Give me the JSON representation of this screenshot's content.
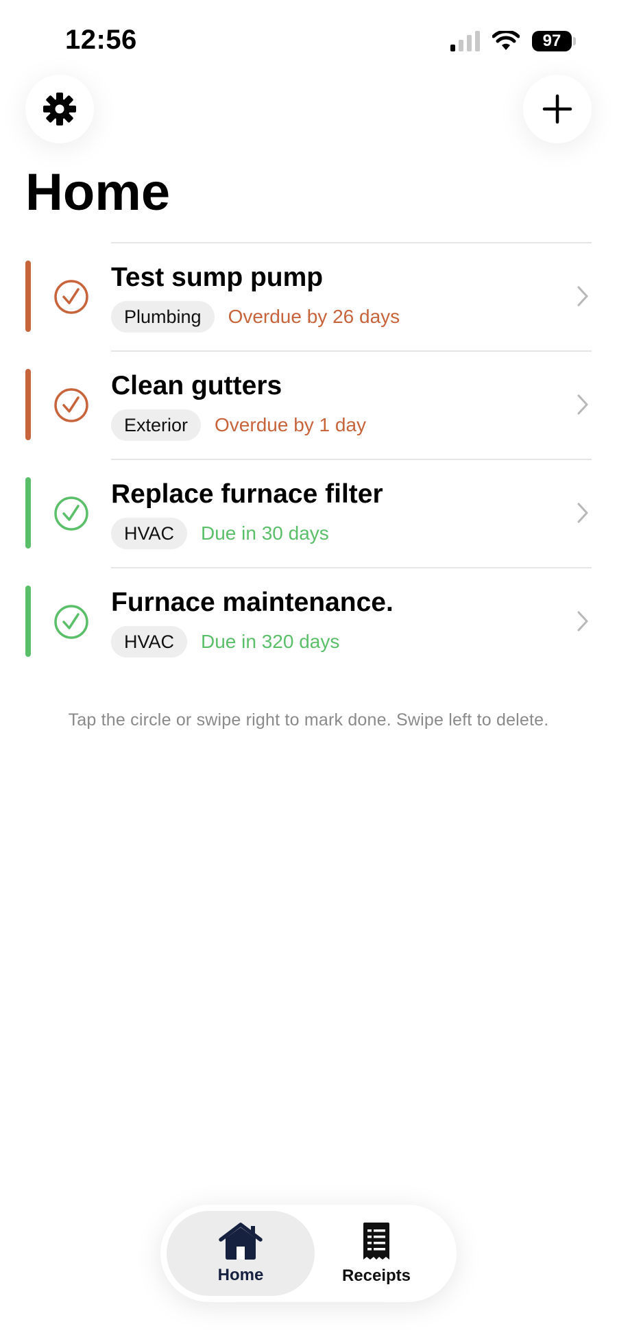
{
  "status_bar": {
    "time": "12:56",
    "battery": "97"
  },
  "header": {
    "settings_icon": "gear-icon",
    "add_icon": "plus-icon",
    "title": "Home"
  },
  "tasks": [
    {
      "title": "Test sump pump",
      "category": "Plumbing",
      "due": "Overdue by 26 days",
      "color": "#c8643c"
    },
    {
      "title": "Clean gutters",
      "category": "Exterior",
      "due": "Overdue by 1 day",
      "color": "#c8643c"
    },
    {
      "title": "Replace furnace filter",
      "category": "HVAC",
      "due": "Due in 30 days",
      "color": "#5bbf6a"
    },
    {
      "title": "Furnace maintenance.",
      "category": "HVAC",
      "due": "Due in 320 days",
      "color": "#5bbf6a"
    }
  ],
  "hint": "Tap the circle or swipe right to mark done. Swipe left to delete.",
  "tab_bar": {
    "home_label": "Home",
    "home_icon": "house-icon",
    "receipts_label": "Receipts",
    "receipts_icon": "receipt-icon",
    "active_color": "#16213f"
  }
}
